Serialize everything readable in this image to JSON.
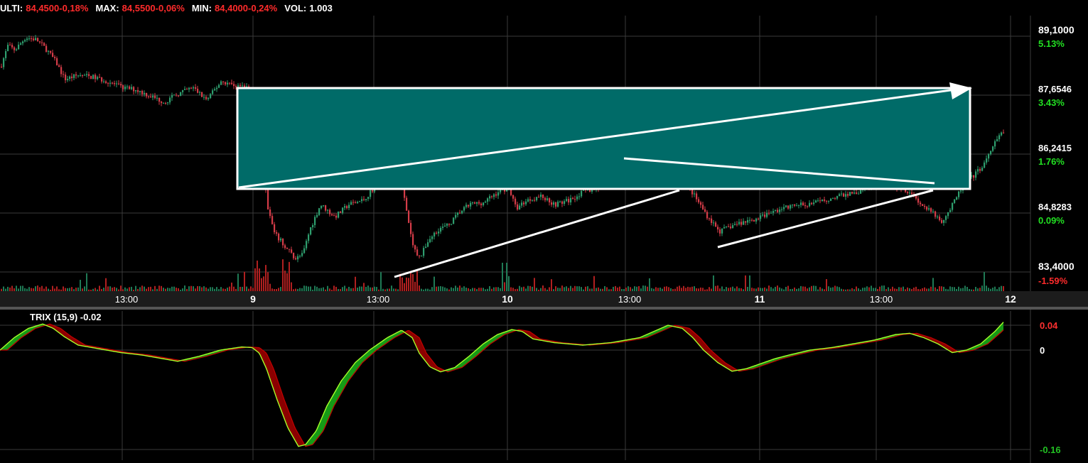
{
  "header": {
    "ulti_label": "ULTI:",
    "ulti_value": "84,4500-0,18%",
    "max_label": "MAX:",
    "max_value": "84,5500-0,06%",
    "min_label": "MIN:",
    "min_value": "84,4000-0,24%",
    "vol_label": "VOL:",
    "vol_value": "1.003"
  },
  "colors": {
    "up": "#2e9e6e",
    "down": "#d43c48",
    "grid": "#3a3a3a",
    "zone": "#006b68",
    "trix_green": "#169a16",
    "trix_red": "#8b0000",
    "trix_line": "#a6ff2a"
  },
  "chart_data": [
    {
      "type": "candlestick",
      "x_ticks": [
        "13:00",
        "9",
        "13:00",
        "10",
        "13:00",
        "11",
        "13:00",
        "12"
      ],
      "y_ticks": [
        {
          "price": "89,1000",
          "pct": "5.13%",
          "value": 89.1
        },
        {
          "price": "87,6546",
          "pct": "3.43%",
          "value": 87.6546
        },
        {
          "price": "86,2415",
          "pct": "1.76%",
          "value": 86.2415
        },
        {
          "price": "84,8283",
          "pct": "0.09%",
          "value": 84.8283
        },
        {
          "price": "83,4000",
          "pct": "-1.59%",
          "value": 83.4
        }
      ],
      "ylim": [
        83.3,
        89.3
      ],
      "price_path": [
        [
          0,
          88.2
        ],
        [
          10,
          88.7
        ],
        [
          20,
          88.6
        ],
        [
          35,
          88.9
        ],
        [
          50,
          88.85
        ],
        [
          65,
          88.6
        ],
        [
          78,
          88.3
        ],
        [
          90,
          87.9
        ],
        [
          110,
          88.0
        ],
        [
          130,
          87.95
        ],
        [
          150,
          87.85
        ],
        [
          170,
          87.7
        ],
        [
          190,
          87.65
        ],
        [
          210,
          87.5
        ],
        [
          230,
          87.35
        ],
        [
          250,
          87.55
        ],
        [
          270,
          87.7
        ],
        [
          290,
          87.4
        ],
        [
          310,
          87.85
        ],
        [
          330,
          87.75
        ],
        [
          350,
          87.7
        ],
        [
          358,
          87.6
        ],
        [
          362,
          86.5
        ],
        [
          368,
          86.0
        ],
        [
          375,
          84.9
        ],
        [
          385,
          84.2
        ],
        [
          400,
          83.9
        ],
        [
          415,
          83.6
        ],
        [
          425,
          83.7
        ],
        [
          435,
          84.3
        ],
        [
          450,
          84.9
        ],
        [
          470,
          84.6
        ],
        [
          490,
          84.9
        ],
        [
          510,
          85.0
        ],
        [
          530,
          85.4
        ],
        [
          550,
          85.6
        ],
        [
          562,
          85.7
        ],
        [
          570,
          84.8
        ],
        [
          580,
          83.9
        ],
        [
          590,
          83.6
        ],
        [
          600,
          84.0
        ],
        [
          615,
          84.3
        ],
        [
          630,
          84.4
        ],
        [
          645,
          84.7
        ],
        [
          660,
          84.9
        ],
        [
          680,
          84.95
        ],
        [
          700,
          85.2
        ],
        [
          715,
          85.3
        ],
        [
          725,
          84.8
        ],
        [
          740,
          85.0
        ],
        [
          760,
          85.1
        ],
        [
          780,
          84.9
        ],
        [
          800,
          85.0
        ],
        [
          820,
          85.2
        ],
        [
          840,
          85.3
        ],
        [
          860,
          85.45
        ],
        [
          880,
          85.5
        ],
        [
          900,
          85.6
        ],
        [
          915,
          85.9
        ],
        [
          930,
          86.0
        ],
        [
          945,
          85.95
        ],
        [
          958,
          85.7
        ],
        [
          965,
          85.4
        ],
        [
          980,
          85.0
        ],
        [
          995,
          84.6
        ],
        [
          1012,
          84.25
        ],
        [
          1030,
          84.4
        ],
        [
          1050,
          84.5
        ],
        [
          1070,
          84.6
        ],
        [
          1090,
          84.75
        ],
        [
          1110,
          84.85
        ],
        [
          1130,
          84.9
        ],
        [
          1150,
          84.95
        ],
        [
          1170,
          85.05
        ],
        [
          1190,
          85.15
        ],
        [
          1210,
          85.2
        ],
        [
          1230,
          85.45
        ],
        [
          1245,
          85.5
        ],
        [
          1260,
          85.35
        ],
        [
          1280,
          85.2
        ],
        [
          1295,
          84.9
        ],
        [
          1310,
          84.7
        ],
        [
          1325,
          84.5
        ],
        [
          1340,
          84.9
        ],
        [
          1355,
          85.4
        ],
        [
          1370,
          85.6
        ],
        [
          1385,
          85.9
        ],
        [
          1400,
          86.4
        ],
        [
          1412,
          86.7
        ]
      ],
      "trix_path": [
        [
          0,
          0.0
        ],
        [
          20,
          0.02
        ],
        [
          40,
          0.035
        ],
        [
          60,
          0.042
        ],
        [
          75,
          0.035
        ],
        [
          90,
          0.022
        ],
        [
          110,
          0.008
        ],
        [
          140,
          0.002
        ],
        [
          170,
          -0.004
        ],
        [
          200,
          -0.008
        ],
        [
          230,
          -0.014
        ],
        [
          250,
          -0.018
        ],
        [
          280,
          -0.01
        ],
        [
          310,
          0.0
        ],
        [
          340,
          0.005
        ],
        [
          355,
          0.004
        ],
        [
          365,
          -0.005
        ],
        [
          375,
          -0.03
        ],
        [
          390,
          -0.08
        ],
        [
          405,
          -0.125
        ],
        [
          420,
          -0.155
        ],
        [
          430,
          -0.152
        ],
        [
          445,
          -0.13
        ],
        [
          460,
          -0.09
        ],
        [
          480,
          -0.05
        ],
        [
          500,
          -0.02
        ],
        [
          520,
          0.0
        ],
        [
          545,
          0.02
        ],
        [
          565,
          0.032
        ],
        [
          580,
          0.02
        ],
        [
          590,
          -0.005
        ],
        [
          605,
          -0.027
        ],
        [
          620,
          -0.035
        ],
        [
          640,
          -0.028
        ],
        [
          660,
          -0.01
        ],
        [
          680,
          0.01
        ],
        [
          700,
          0.025
        ],
        [
          720,
          0.033
        ],
        [
          735,
          0.03
        ],
        [
          750,
          0.018
        ],
        [
          780,
          0.012
        ],
        [
          820,
          0.008
        ],
        [
          860,
          0.012
        ],
        [
          900,
          0.02
        ],
        [
          920,
          0.03
        ],
        [
          940,
          0.04
        ],
        [
          960,
          0.035
        ],
        [
          975,
          0.02
        ],
        [
          990,
          0.0
        ],
        [
          1010,
          -0.02
        ],
        [
          1030,
          -0.034
        ],
        [
          1050,
          -0.03
        ],
        [
          1070,
          -0.022
        ],
        [
          1090,
          -0.014
        ],
        [
          1110,
          -0.008
        ],
        [
          1140,
          0.0
        ],
        [
          1170,
          0.004
        ],
        [
          1200,
          0.01
        ],
        [
          1230,
          0.016
        ],
        [
          1260,
          0.025
        ],
        [
          1280,
          0.027
        ],
        [
          1300,
          0.02
        ],
        [
          1320,
          0.01
        ],
        [
          1340,
          -0.004
        ],
        [
          1360,
          0.0
        ],
        [
          1380,
          0.01
        ],
        [
          1400,
          0.03
        ],
        [
          1412,
          0.045
        ]
      ],
      "indicator": {
        "label": "TRIX (15,9) -0.02",
        "ticks": [
          {
            "label": "0.04",
            "value": 0.04
          },
          {
            "label": "0",
            "value": 0
          },
          {
            "label": "-0.16",
            "value": -0.16
          }
        ],
        "ylim": [
          -0.18,
          0.065
        ]
      }
    }
  ]
}
